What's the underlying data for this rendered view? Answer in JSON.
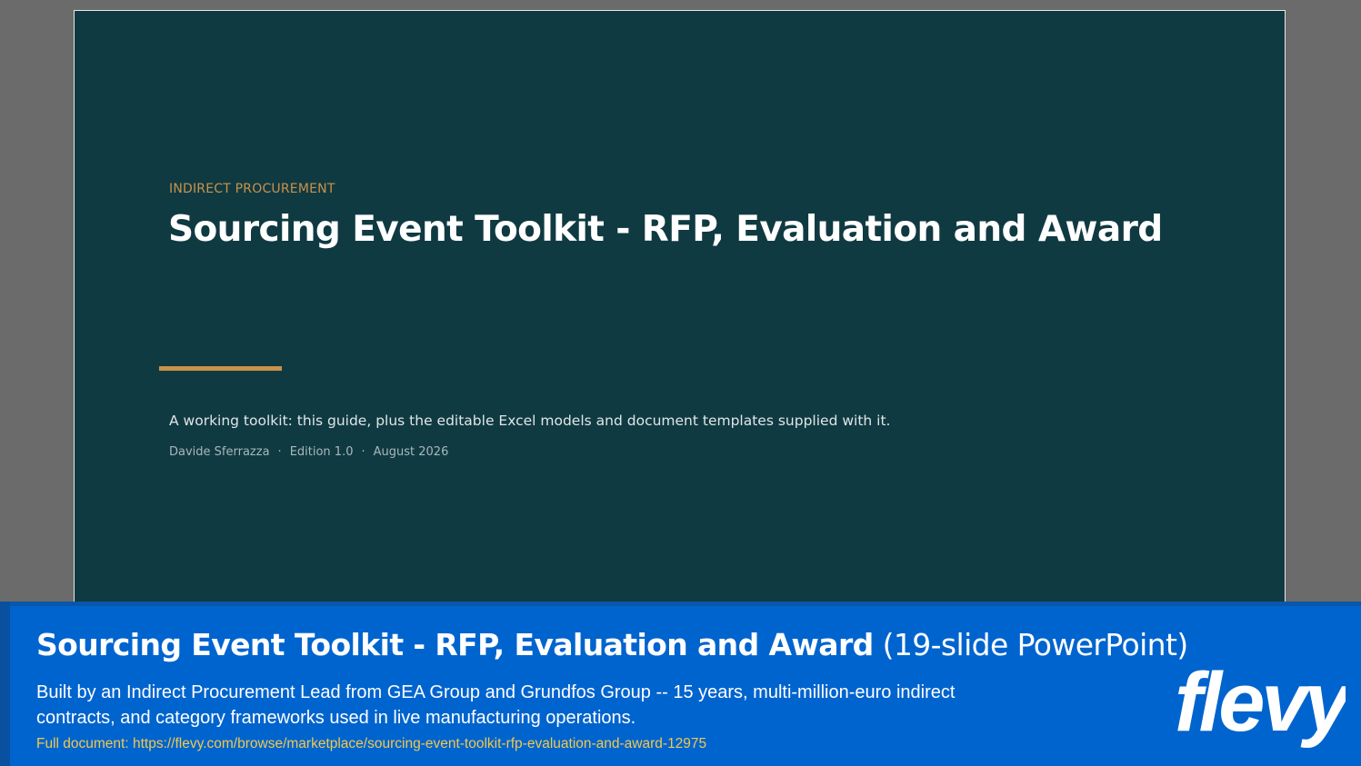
{
  "slide": {
    "kicker": "INDIRECT PROCUREMENT",
    "title": "Sourcing Event Toolkit - RFP, Evaluation and Award",
    "subtitle": "A working toolkit: this guide, plus the editable Excel models and document templates supplied with it.",
    "author": "Davide Sferrazza",
    "edition": "Edition 1.0",
    "date": "August 2026",
    "separator": "·"
  },
  "banner": {
    "title_bold": "Sourcing Event Toolkit - RFP, Evaluation and Award",
    "title_light": "(19-slide PowerPoint)",
    "description": "Built by an Indirect Procurement Lead from GEA Group and Grundfos Group -- 15 years, multi-million-euro indirect contracts, and category frameworks used in live manufacturing operations.",
    "link_text": "Full document: https://flevy.com/browse/marketplace/sourcing-event-toolkit-rfp-evaluation-and-award-12975",
    "logo_text": "flevy"
  },
  "colors": {
    "slide_background": "#103a42",
    "accent_gold": "#c9924a",
    "banner_blue": "#0064cf",
    "link_yellow": "#f2c94c"
  }
}
